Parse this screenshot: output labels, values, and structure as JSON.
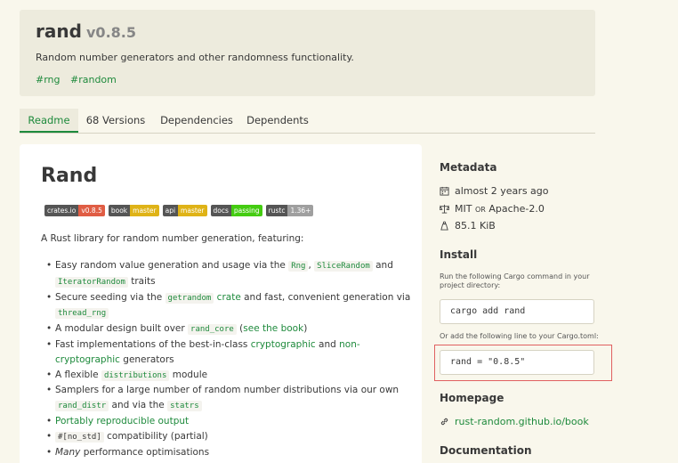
{
  "crate": {
    "name": "rand",
    "version": "v0.8.5",
    "description": "Random number generators and other randomness functionality.",
    "keywords": [
      "#rng",
      "#random"
    ]
  },
  "tabs": [
    {
      "label": "Readme",
      "active": true
    },
    {
      "label": "68 Versions",
      "active": false
    },
    {
      "label": "Dependencies",
      "active": false
    },
    {
      "label": "Dependents",
      "active": false
    }
  ],
  "readme": {
    "title": "Rand",
    "badges": [
      {
        "left": "crates.io",
        "right": "v0.8.5",
        "left_color": "#555555",
        "right_color": "#e05d44"
      },
      {
        "left": "book",
        "right": "master",
        "left_color": "#555555",
        "right_color": "#dfb317"
      },
      {
        "left": "api",
        "right": "master",
        "left_color": "#555555",
        "right_color": "#dfb317"
      },
      {
        "left": "docs",
        "right": "passing",
        "left_color": "#555555",
        "right_color": "#4c1"
      },
      {
        "left": "rustc",
        "right": "1.36+",
        "left_color": "#555555",
        "right_color": "#9f9f9f"
      }
    ],
    "intro": "A Rust library for random number generation, featuring:",
    "features": {
      "f1_a": "Easy random value generation and usage via the",
      "f1_code1": "Rng",
      "f1_sep": ",",
      "f1_code2": "SliceRandom",
      "f1_and": "and",
      "f1_code3": "IteratorRandom",
      "f1_b": "traits",
      "f2_a": "Secure seeding via the",
      "f2_code1": "getrandom",
      "f2_link": "crate",
      "f2_b": "and fast, convenient generation via",
      "f2_code2": "thread_rng",
      "f3_a": "A modular design built over",
      "f3_code": "rand_core",
      "f3_open": "(",
      "f3_link": "see the book",
      "f3_close": ")",
      "f4_a": "Fast implementations of the best-in-class",
      "f4_link1": "cryptographic",
      "f4_and": "and",
      "f4_link2": "non-cryptographic",
      "f4_b": "generators",
      "f5_a": "A flexible",
      "f5_code": "distributions",
      "f5_b": "module",
      "f6_a": "Samplers for a large number of random number distributions via our own",
      "f6_code1": "rand_distr",
      "f6_b": "and via the",
      "f6_code2": "statrs",
      "f7_link": "Portably reproducible output",
      "f8_code": "#[no_std]",
      "f8_b": "compatibility (partial)",
      "f9_em": "Many",
      "f9_b": "performance optimisations"
    }
  },
  "sidebar": {
    "metadata_heading": "Metadata",
    "updated": "almost 2 years ago",
    "license_a": "MIT",
    "license_or": "OR",
    "license_b": "Apache-2.0",
    "size": "85.1 KiB",
    "install_heading": "Install",
    "install_note": "Run the following Cargo command in your project directory:",
    "install_cmd": "cargo add rand",
    "toml_note": "Or add the following line to your Cargo.toml:",
    "toml_line": "rand = \"0.8.5\"",
    "homepage_heading": "Homepage",
    "homepage_link": "rust-random.github.io/book",
    "documentation_heading": "Documentation"
  },
  "icons": {
    "calendar": "calendar-icon",
    "license": "scale-icon",
    "size": "weight-icon",
    "link": "link-icon"
  },
  "colors": {
    "accent": "#1e8a3c",
    "highlight": "#e06060"
  }
}
